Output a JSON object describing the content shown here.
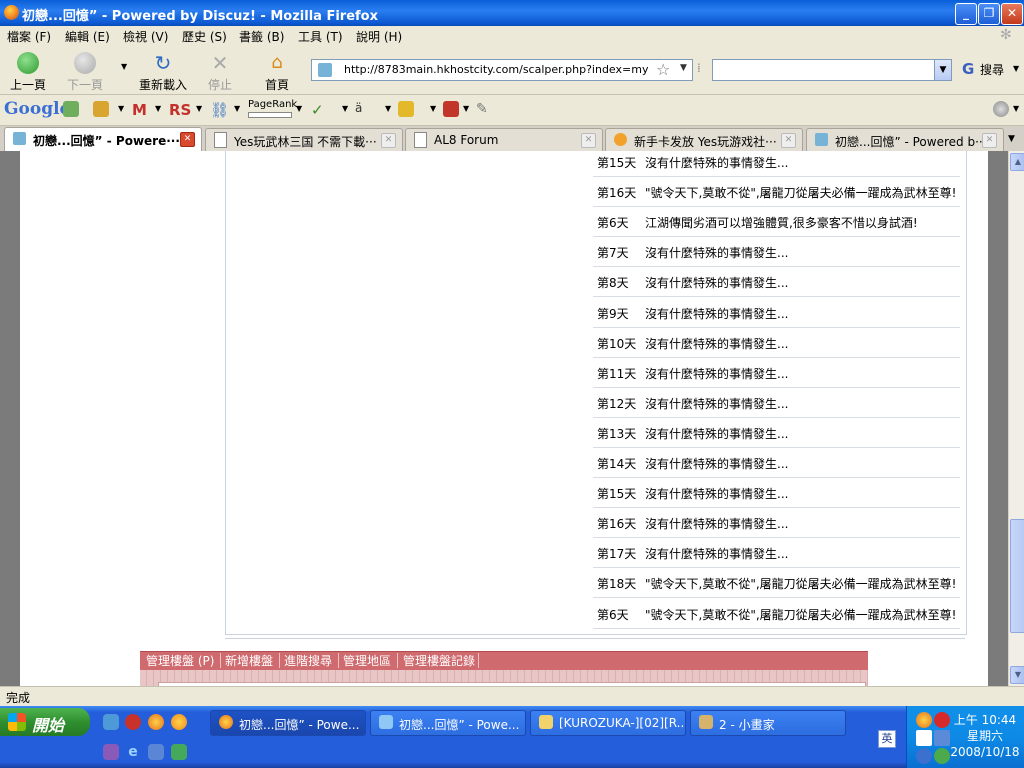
{
  "window": {
    "title": "初戀...回憶” - Powered by Discuz! - Mozilla Firefox",
    "controls": [
      "_",
      "❐",
      "✕"
    ]
  },
  "menu": [
    "檔案 (F)",
    "編輯 (E)",
    "檢視 (V)",
    "歷史 (S)",
    "書籤 (B)",
    "工具 (T)",
    "說明 (H)"
  ],
  "nav": {
    "back": "上一頁",
    "forward": "下一頁",
    "reload": "重新載入",
    "stop": "停止",
    "home": "首頁",
    "url": "http://8783main.hkhostcity.com/scalper.php?index=my",
    "search_label": "搜尋",
    "search_value": ""
  },
  "google_toolbar": {
    "logo": "Google",
    "pagerank_label": "PageRank"
  },
  "tabs": [
    {
      "label": "初戀...回憶” - Powere···",
      "active": true
    },
    {
      "label": "Yes玩武林三国 不需下載···",
      "active": false
    },
    {
      "label": "AL8 Forum",
      "active": false
    },
    {
      "label": "新手卡发放 Yes玩游戏社···",
      "active": false
    },
    {
      "label": "初戀...回憶” - Powered b···",
      "active": false
    }
  ],
  "log": [
    {
      "day": "第15天",
      "msg": "沒有什麼特殊的事情發生..."
    },
    {
      "day": "第16天",
      "msg": "\"號令天下,莫敢不從\",屠龍刀從屠夫必備一躍成為武林至尊!"
    },
    {
      "day": "第6天",
      "msg": "江湖傳聞劣酒可以增強體質,很多豪客不惜以身試酒!"
    },
    {
      "day": "第7天",
      "msg": "沒有什麼特殊的事情發生..."
    },
    {
      "day": "第8天",
      "msg": "沒有什麼特殊的事情發生..."
    },
    {
      "day": "第9天",
      "msg": "沒有什麼特殊的事情發生..."
    },
    {
      "day": "第10天",
      "msg": "沒有什麼特殊的事情發生..."
    },
    {
      "day": "第11天",
      "msg": "沒有什麼特殊的事情發生..."
    },
    {
      "day": "第12天",
      "msg": "沒有什麼特殊的事情發生..."
    },
    {
      "day": "第13天",
      "msg": "沒有什麼特殊的事情發生..."
    },
    {
      "day": "第14天",
      "msg": "沒有什麼特殊的事情發生..."
    },
    {
      "day": "第15天",
      "msg": "沒有什麼特殊的事情發生..."
    },
    {
      "day": "第16天",
      "msg": "沒有什麼特殊的事情發生..."
    },
    {
      "day": "第17天",
      "msg": "沒有什麼特殊的事情發生..."
    },
    {
      "day": "第18天",
      "msg": "\"號令天下,莫敢不從\",屠龍刀從屠夫必備一躍成為武林至尊!"
    },
    {
      "day": "第6天",
      "msg": "\"號令天下,莫敢不從\",屠龍刀從屠夫必備一躍成為武林至尊!"
    }
  ],
  "admin_bar": [
    "管理樓盤 (P)",
    "新增樓盤",
    "進階搜尋",
    "管理地區",
    "管理樓盤記錄"
  ],
  "status": "完成",
  "taskbar": {
    "start": "開始",
    "tasks": [
      {
        "label": "初戀...回憶” - Powe...",
        "active": true
      },
      {
        "label": "初戀...回憶” - Powe...",
        "active": false
      },
      {
        "label": "[KUROZUKA-][02][R...",
        "active": false
      },
      {
        "label": "2 - 小畫家",
        "active": false
      }
    ],
    "clock_time": "上午 10:44",
    "clock_day": "星期六",
    "clock_date": "2008/10/18",
    "lang": "英"
  },
  "colors": {
    "titlebar": "#0b57d0",
    "admin_bar": "#cf6a6e",
    "taskbar": "#245edb"
  }
}
